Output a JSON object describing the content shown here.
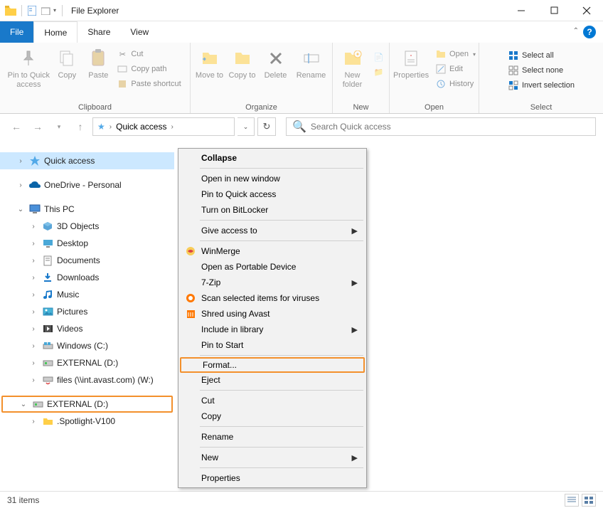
{
  "title": "File Explorer",
  "tabs": {
    "file": "File",
    "home": "Home",
    "share": "Share",
    "view": "View"
  },
  "ribbon": {
    "clipboard_label": "Clipboard",
    "organize_label": "Organize",
    "new_label": "New",
    "open_label": "Open",
    "select_label": "Select",
    "pin": "Pin to Quick access",
    "copy": "Copy",
    "paste": "Paste",
    "cut": "Cut",
    "copy_path": "Copy path",
    "paste_shortcut": "Paste shortcut",
    "move_to": "Move to",
    "copy_to": "Copy to",
    "delete": "Delete",
    "rename": "Rename",
    "new_folder": "New folder",
    "properties": "Properties",
    "open": "Open",
    "edit": "Edit",
    "history": "History",
    "select_all": "Select all",
    "select_none": "Select none",
    "invert_sel": "Invert selection"
  },
  "address": {
    "quick_access": "Quick access"
  },
  "search": {
    "placeholder": "Search Quick access"
  },
  "tree": {
    "quick_access": "Quick access",
    "onedrive": "OneDrive - Personal",
    "this_pc": "This PC",
    "objects_3d": "3D Objects",
    "desktop": "Desktop",
    "documents": "Documents",
    "downloads": "Downloads",
    "music": "Music",
    "pictures": "Pictures",
    "videos": "Videos",
    "windows_c": "Windows (C:)",
    "external_d": "EXTERNAL (D:)",
    "files_w": "files (\\\\int.avast.com) (W:)",
    "external_d2": "EXTERNAL (D:)",
    "spotlight": ".Spotlight-V100"
  },
  "context_menu": {
    "collapse": "Collapse",
    "open_new_window": "Open in new window",
    "pin_quick": "Pin to Quick access",
    "bitlocker": "Turn on BitLocker",
    "give_access": "Give access to",
    "winmerge": "WinMerge",
    "portable_device": "Open as Portable Device",
    "seven_zip": "7-Zip",
    "scan_viruses": "Scan selected items for viruses",
    "shred_avast": "Shred using Avast",
    "include_library": "Include in library",
    "pin_start": "Pin to Start",
    "format": "Format...",
    "eject": "Eject",
    "cut": "Cut",
    "copy": "Copy",
    "rename": "Rename",
    "new": "New",
    "properties": "Properties"
  },
  "status": {
    "items": "31 items"
  }
}
